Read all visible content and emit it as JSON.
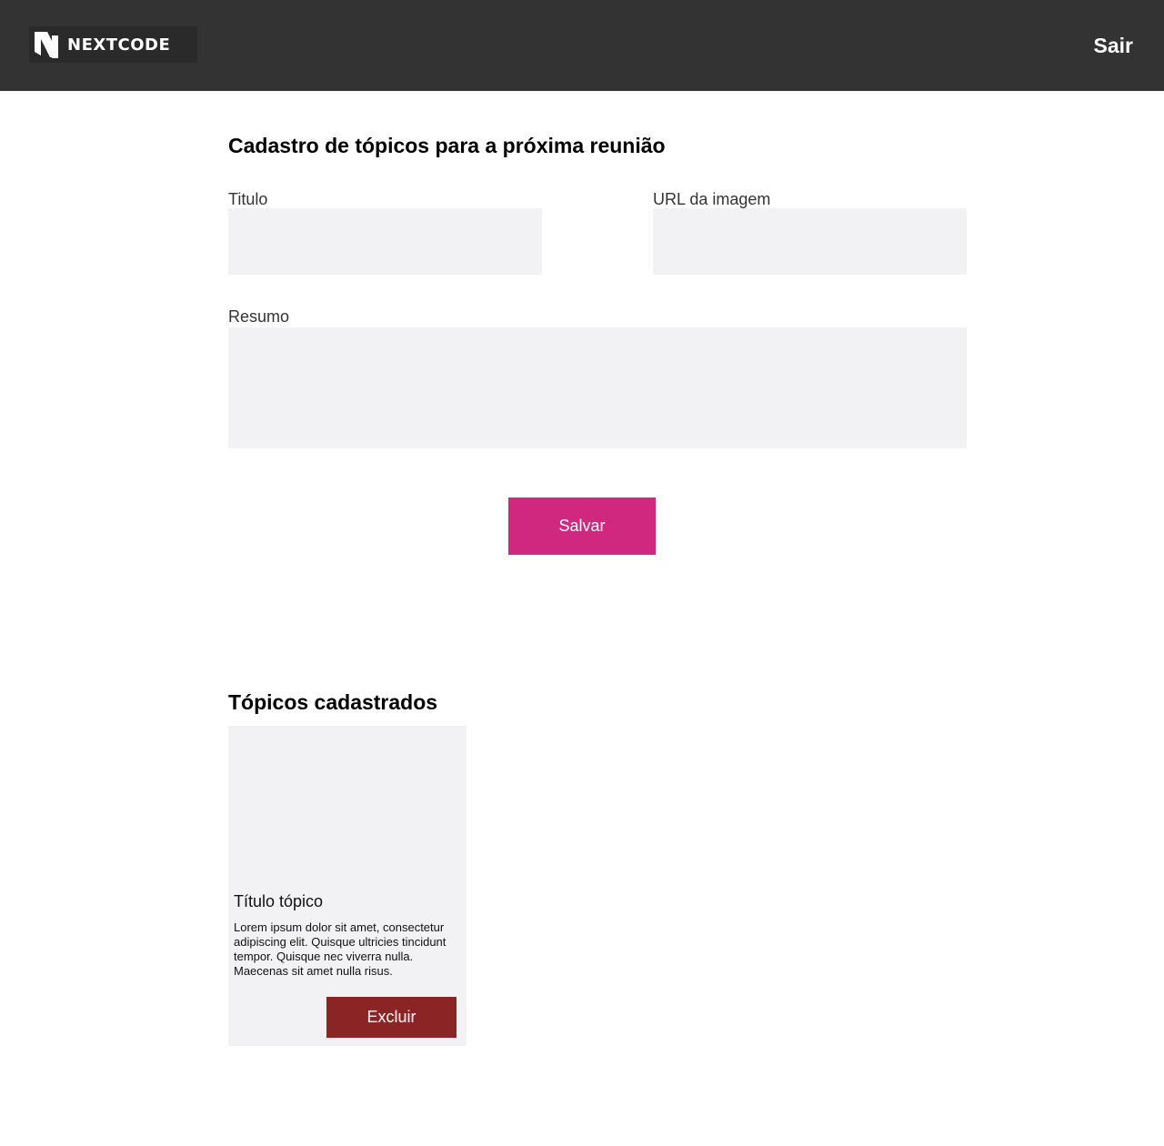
{
  "header": {
    "logo_text": "NEXTCODE",
    "logo_icon": "nextcode-logo-icon",
    "logout_label": "Sair"
  },
  "form": {
    "title": "Cadastro de tópicos para a próxima reunião",
    "title_field": {
      "label": "Titulo",
      "value": ""
    },
    "image_url_field": {
      "label": "URL da imagem",
      "value": ""
    },
    "summary_field": {
      "label": "Resumo",
      "value": ""
    },
    "save_label": "Salvar"
  },
  "topics": {
    "title": "Tópicos cadastrados",
    "items": [
      {
        "title": "Título tópico",
        "summary": "Lorem ipsum dolor sit amet, consectetur adipiscing elit. Quisque ultricies tincidunt tempor. Quisque nec viverra nulla. Maecenas sit amet nulla risus.",
        "delete_label": "Excluir"
      }
    ]
  },
  "colors": {
    "header_bg": "#333333",
    "input_bg": "#f2f2f4",
    "save_button": "#d1287f",
    "delete_button": "#8b2525"
  }
}
